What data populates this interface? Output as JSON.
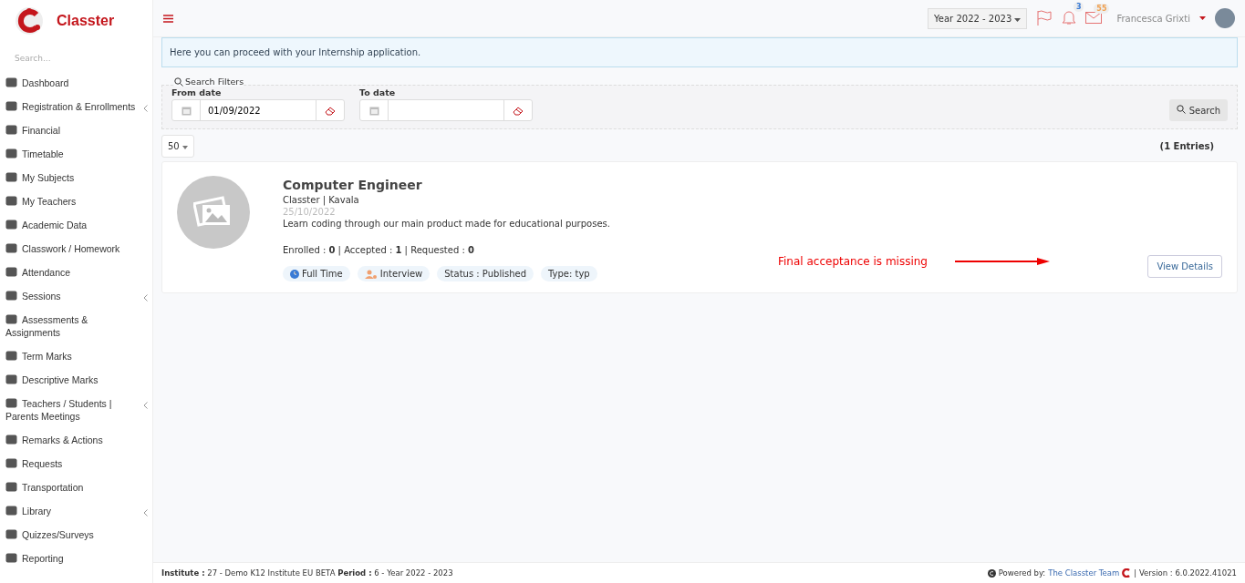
{
  "brand": {
    "name": "Classter"
  },
  "sidebar": {
    "search_placeholder": "Search...",
    "items": [
      {
        "label": "Dashboard",
        "has_submenu": false
      },
      {
        "label": "Registration & Enrollments",
        "has_submenu": true
      },
      {
        "label": "Financial",
        "has_submenu": false
      },
      {
        "label": "Timetable",
        "has_submenu": false
      },
      {
        "label": "My Subjects",
        "has_submenu": false
      },
      {
        "label": "My Teachers",
        "has_submenu": false
      },
      {
        "label": "Academic Data",
        "has_submenu": false
      },
      {
        "label": "Classwork / Homework",
        "has_submenu": false
      },
      {
        "label": "Attendance",
        "has_submenu": false
      },
      {
        "label": "Sessions",
        "has_submenu": true
      },
      {
        "label": "Assessments & Assignments",
        "has_submenu": false
      },
      {
        "label": "Term Marks",
        "has_submenu": false
      },
      {
        "label": "Descriptive Marks",
        "has_submenu": false
      },
      {
        "label": "Teachers / Students | Parents Meetings",
        "has_submenu": true
      },
      {
        "label": "Remarks & Actions",
        "has_submenu": false
      },
      {
        "label": "Requests",
        "has_submenu": false
      },
      {
        "label": "Transportation",
        "has_submenu": false
      },
      {
        "label": "Library",
        "has_submenu": true
      },
      {
        "label": "Quizzes/Surveys",
        "has_submenu": false
      },
      {
        "label": "Reporting",
        "has_submenu": false
      }
    ]
  },
  "topbar": {
    "year": "Year 2022 - 2023",
    "notifications": "3",
    "messages": "55",
    "user": "Francesca Grixti"
  },
  "info": "Here you can proceed with your Internship application.",
  "filters": {
    "legend": "Search Filters",
    "from_label": "From date",
    "from_value": "01/09/2022",
    "to_label": "To date",
    "search_button": "Search"
  },
  "page_size": "50",
  "entries": "(1 Entries)",
  "card": {
    "title": "Computer Engineer",
    "org": "Classter | Kavala",
    "date": "25/10/2022",
    "description": "Learn coding through our main product made for educational purposes.",
    "counts": "Enrolled : **0** | Accepted : **1** | Requested : **0**",
    "tags": [
      {
        "label": "Full Time",
        "kind": "clock"
      },
      {
        "label": "Interview",
        "kind": "person"
      },
      {
        "label": "Status : Published",
        "kind": "plain"
      },
      {
        "label": "Type: typ",
        "kind": "plain"
      }
    ],
    "details_button": "View Details"
  },
  "annotation": "Final acceptance is missing",
  "footer": {
    "left": "**Institute :** 27 - Demo K12 Institute EU BETA **Period :** 6 - Year 2022 - 2023",
    "powered": "Powered by:",
    "link": "The Classter Team",
    "version": "| Version : 6.0.2022.41021"
  }
}
